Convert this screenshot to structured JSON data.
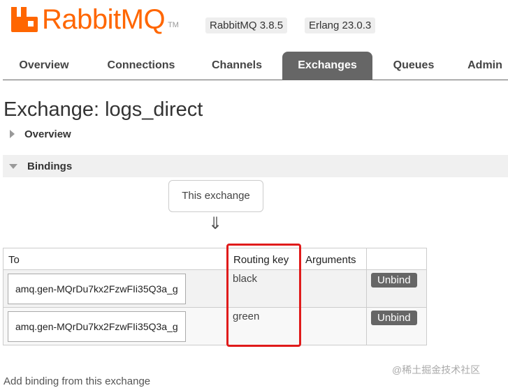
{
  "header": {
    "logo_text": "RabbitMQ",
    "logo_tm": "TM",
    "rabbitmq_version": "RabbitMQ 3.8.5",
    "erlang_version": "Erlang 23.0.3",
    "brand_color": "#ff6600"
  },
  "tabs": [
    {
      "label": "Overview",
      "active": false
    },
    {
      "label": "Connections",
      "active": false
    },
    {
      "label": "Channels",
      "active": false
    },
    {
      "label": "Exchanges",
      "active": true
    },
    {
      "label": "Queues",
      "active": false
    },
    {
      "label": "Admin",
      "active": false
    }
  ],
  "page": {
    "title": "Exchange: logs_direct"
  },
  "sections": {
    "overview_label": "Overview",
    "bindings_label": "Bindings"
  },
  "bindings": {
    "source_label": "This exchange",
    "arrow": "⇓",
    "columns": [
      "To",
      "Routing key",
      "Arguments",
      ""
    ],
    "rows": [
      {
        "to": "amq.gen-MQrDu7kx2FzwFIi35Q3a_g",
        "routing_key": "black",
        "arguments": "",
        "action": "Unbind"
      },
      {
        "to": "amq.gen-MQrDu7kx2FzwFIi35Q3a_g",
        "routing_key": "green",
        "arguments": "",
        "action": "Unbind"
      }
    ],
    "add_binding_label": "Add binding from this exchange"
  },
  "watermark": "@稀土掘金技术社区"
}
